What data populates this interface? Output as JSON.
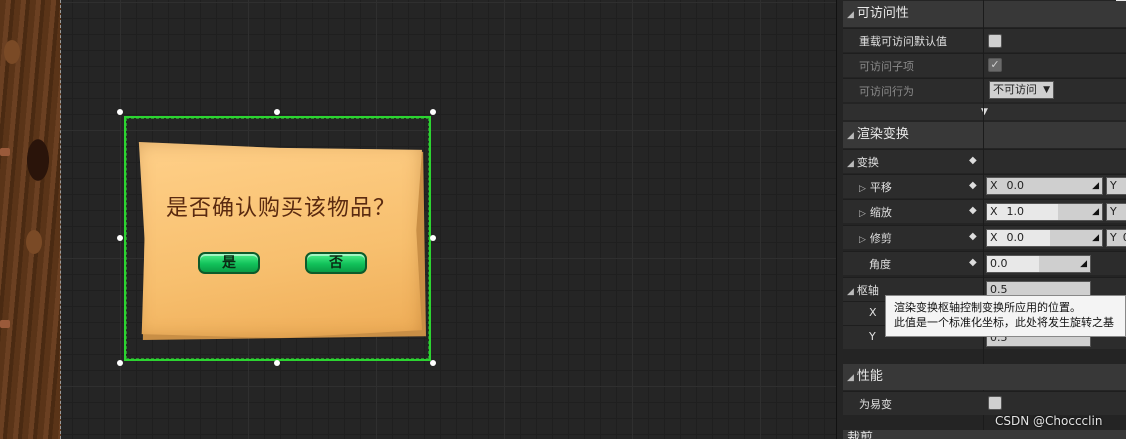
{
  "game_dialog": {
    "question": "是否确认购买该物品？",
    "yes_label": "是",
    "no_label": "否"
  },
  "details": {
    "accessibility": {
      "title": "可访问性",
      "override_default": "重载可访问默认值",
      "child_items": "可访问子项",
      "behavior_label": "可访问行为",
      "behavior_value": "不可访问"
    },
    "render_transform": {
      "title": "渲染变换",
      "transform_group": "变换",
      "translation": {
        "label": "平移",
        "x_axis": "X",
        "x_value": "0.0",
        "y_axis": "Y"
      },
      "scale": {
        "label": "缩放",
        "x_axis": "X",
        "x_value": "1.0",
        "y_axis": "Y"
      },
      "shear": {
        "label": "修剪",
        "x_axis": "X",
        "x_value": "0.0",
        "y_axis": "Y",
        "y_value": "0"
      },
      "angle": {
        "label": "角度",
        "value": "0.0"
      },
      "pivot": {
        "label": "枢轴",
        "x_label": "X",
        "y_label": "Y",
        "x_value": "0.5",
        "y_value": "0.5"
      }
    },
    "performance": {
      "title": "性能",
      "volatile_label": "为易变"
    },
    "next_section": "裁剪"
  },
  "tooltip": {
    "line1": "渲染变换枢轴控制变换所应用的位置。",
    "line2": "此值是一个标准化坐标，此处将发生旋转之基"
  },
  "watermark": "CSDN @Choccclin",
  "colors": {
    "selection": "#2cd431",
    "button_green": "#12c25a",
    "panel_bg": "#242424"
  }
}
